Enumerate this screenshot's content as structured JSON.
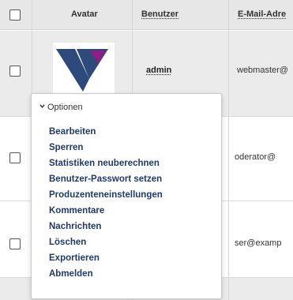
{
  "table": {
    "columns": {
      "avatar": "Avatar",
      "user": "Benutzer",
      "email": "E-Mail-Adre"
    },
    "rows": [
      {
        "username": "admin",
        "email": "webmaster@",
        "avatar_icon": "vivaldi-logo-icon"
      },
      {
        "username": "",
        "email": "oderator@"
      },
      {
        "username": "",
        "email": "ser@examp"
      }
    ]
  },
  "dropdown": {
    "header": "Optionen",
    "items": [
      "Bearbeiten",
      "Sperren",
      "Statistiken neuberechnen",
      "Benutzer-Passwort setzen",
      "Produzenteneinstellungen",
      "Kommentare",
      "Nachrichten",
      "Löschen",
      "Exportieren",
      "Abmelden"
    ]
  },
  "colors": {
    "header_bg": "#e7e7e7",
    "row_grey": "#ebebeb",
    "link": "#1f3a6b",
    "logo_blue": "#2d4a7a",
    "logo_purple": "#8b1f86"
  }
}
